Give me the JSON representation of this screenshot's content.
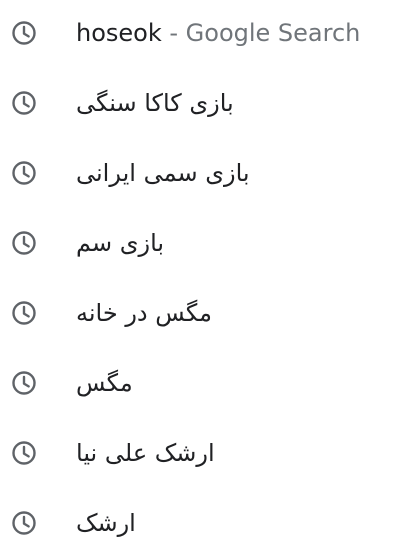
{
  "history": {
    "items": [
      {
        "icon": "clock-icon",
        "query": "hoseok",
        "suffix": " - Google Search",
        "dir": "ltr"
      },
      {
        "icon": "clock-icon",
        "query": "بازی کاکا سنگی",
        "suffix": "",
        "dir": "rtl"
      },
      {
        "icon": "clock-icon",
        "query": "بازی سمی ایرانی",
        "suffix": "",
        "dir": "rtl"
      },
      {
        "icon": "clock-icon",
        "query": "بازی سم",
        "suffix": "",
        "dir": "rtl"
      },
      {
        "icon": "clock-icon",
        "query": "مگس در خانه",
        "suffix": "",
        "dir": "rtl"
      },
      {
        "icon": "clock-icon",
        "query": "مگس",
        "suffix": "",
        "dir": "rtl"
      },
      {
        "icon": "clock-icon",
        "query": "ارشک علی نیا",
        "suffix": "",
        "dir": "rtl"
      },
      {
        "icon": "clock-icon",
        "query": "ارشک",
        "suffix": "",
        "dir": "rtl"
      }
    ]
  },
  "colors": {
    "text": "#202124",
    "muted": "#70757a",
    "icon": "#5f6368",
    "background": "#ffffff"
  }
}
